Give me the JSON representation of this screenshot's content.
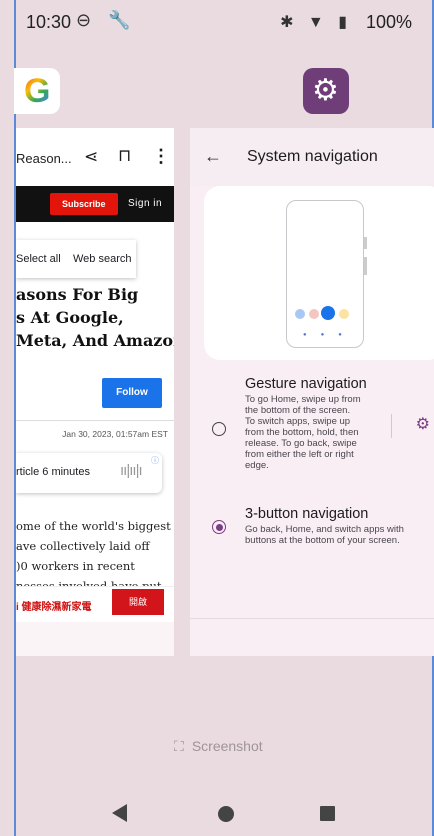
{
  "status_bar": {
    "time": "10:30",
    "left_icons": "⊖ 🔧",
    "right_icons": "✱ ▼ ▮",
    "battery": "100%"
  },
  "browser_card": {
    "tab_title": "Reason...",
    "subscribe_label": "Subscribe",
    "sign_in_label": "Sign in",
    "select_all_label": "Select all",
    "web_search_label": "Web search",
    "headline": [
      "asons For Big",
      "s At Google,",
      "Meta, And Amazon"
    ],
    "follow_label": "Follow",
    "date": "Jan 30, 2023, 01:57am EST",
    "read_time": "rticle  6 minutes",
    "body": [
      "ome of the world's biggest",
      "ave collectively laid off",
      ")0 workers in recent",
      "nesses involved have put"
    ],
    "ad_text": "i 健康除濕新家電",
    "ad_button": "開啟"
  },
  "settings_card": {
    "title": "System navigation",
    "options": [
      {
        "title": "Gesture navigation",
        "description": [
          "To go Home, swipe up from",
          "the bottom of the screen.",
          "To switch apps, swipe up",
          "from the bottom, hold, then",
          "release. To go back, swipe",
          "from either the left or right",
          "edge."
        ],
        "selected": false
      },
      {
        "title": "3-button navigation",
        "description": [
          "Go back, Home, and switch apps with",
          "buttons at the bottom of your screen."
        ],
        "selected": true
      }
    ]
  },
  "screenshot_label": "Screenshot",
  "colors": {
    "background": "#eadbe1",
    "accent": "#7a3d86",
    "subscribe_red": "#e3150a",
    "follow_blue": "#1a73e8"
  }
}
